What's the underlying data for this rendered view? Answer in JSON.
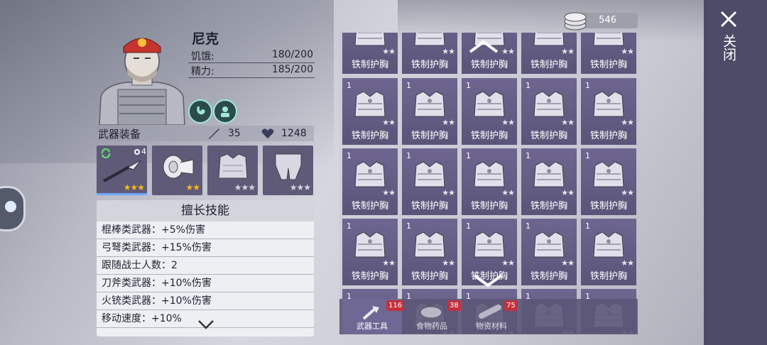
{
  "character": {
    "name": "尼克",
    "stats": [
      {
        "label": "饥饿:",
        "value": "180/200"
      },
      {
        "label": "精力:",
        "value": "185/200"
      }
    ],
    "status_icons": [
      "stomach-icon",
      "morale-icon"
    ]
  },
  "equipment": {
    "title": "武器装备",
    "attack": "35",
    "health": "1248",
    "slots": [
      {
        "icon": "spear-icon",
        "level_badge": "4",
        "stars": 3,
        "max_stars": 3,
        "selected": true
      },
      {
        "icon": "bandage-icon",
        "stars": 2,
        "max_stars": 2
      },
      {
        "icon": "chest-armor-icon",
        "stars": 0,
        "max_stars": 3
      },
      {
        "icon": "leg-armor-icon",
        "stars": 0,
        "max_stars": 3
      }
    ]
  },
  "skills": {
    "title": "擅长技能",
    "rows": [
      "棍棒类武器：+5%伤害",
      "弓弩类武器：+15%伤害",
      "跟随战士人数：2",
      "刀斧类武器：+10%伤害",
      "火铳类武器：+10%伤害",
      "移动速度：+10%"
    ]
  },
  "currency": {
    "value": "546",
    "icon": "coin-stack-icon"
  },
  "inventory": {
    "item_name": "铁制护胸",
    "item_count": "1",
    "stars": 2
  },
  "tabs": [
    {
      "label": "武器工具",
      "badge": "116",
      "icon": "tools-icon",
      "active": true
    },
    {
      "label": "食物药品",
      "badge": "38",
      "icon": "meat-icon",
      "active": false
    },
    {
      "label": "物资材料",
      "badge": "75",
      "icon": "wood-log-icon",
      "active": false
    }
  ],
  "close": {
    "label": "关闭"
  },
  "colors": {
    "item_bg": "#5e5779",
    "panel": "#4c4b68",
    "badge": "#c2313d",
    "gold_star": "#f5b820"
  }
}
